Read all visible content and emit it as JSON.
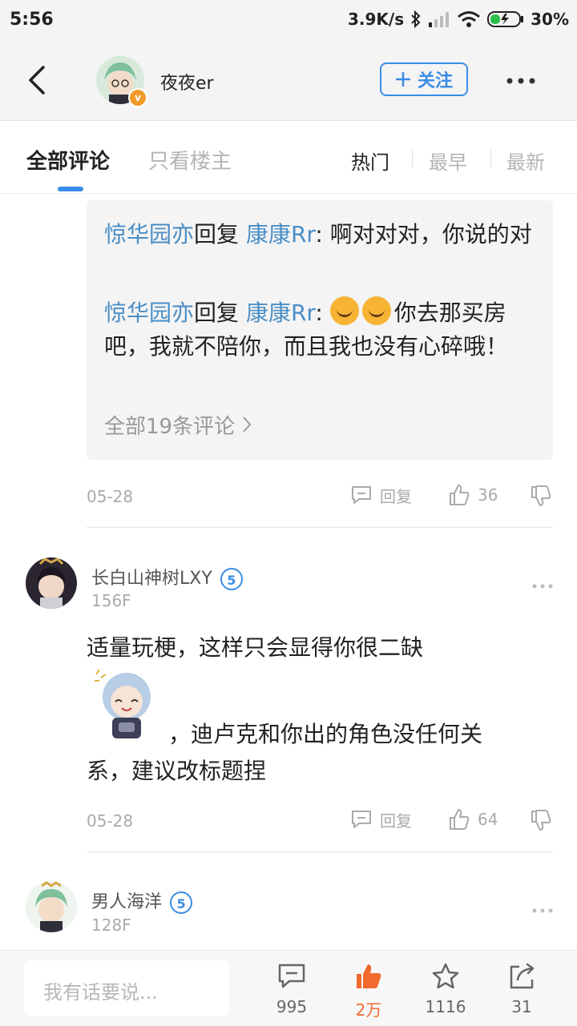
{
  "status_bar": {
    "time": "5:56",
    "network_speed": "3.9K/s",
    "battery": "30%"
  },
  "header": {
    "username": "夜夜er",
    "follow_label": "关注",
    "more_icon": "more-dots-icon"
  },
  "tabs": {
    "all_comments": "全部评论",
    "owner_only": "只看楼主",
    "sort_hot": "热门",
    "sort_earliest": "最早",
    "sort_newest": "最新"
  },
  "reply_box": {
    "replies": [
      {
        "from": "惊华园亦",
        "verb": "回复",
        "to": "康康Rr",
        "text": ": 啊对对对，你说的对"
      },
      {
        "from": "惊华园亦",
        "verb": "回复",
        "to": "康康Rr",
        "text": "你去那买房吧，我就不陪你，而且我也没有心碎哦！"
      }
    ],
    "all_replies_label": "全部19条评论"
  },
  "post1_meta": {
    "date": "05-28",
    "reply_label": "回复",
    "likes": "36"
  },
  "comment1": {
    "name": "长白山神树LXY",
    "level": "5",
    "floor": "156F",
    "text_line1": "适量玩梗，这样只会显得你很二缺",
    "text_line2": "，迪卢克和你出的角色没任何关",
    "text_line3": "系，建议改标题捏",
    "date": "05-28",
    "reply_label": "回复",
    "likes": "64"
  },
  "comment2": {
    "name": "男人海洋",
    "level": "5",
    "floor": "128F"
  },
  "bottom_bar": {
    "input_placeholder": "我有话要说...",
    "comments_count": "995",
    "likes_count": "2万",
    "favorites_count": "1116",
    "shares_count": "31"
  },
  "colors": {
    "accent": "#3a8ce6",
    "name_link": "#4a8ec6",
    "like_active": "#f06a2e"
  }
}
